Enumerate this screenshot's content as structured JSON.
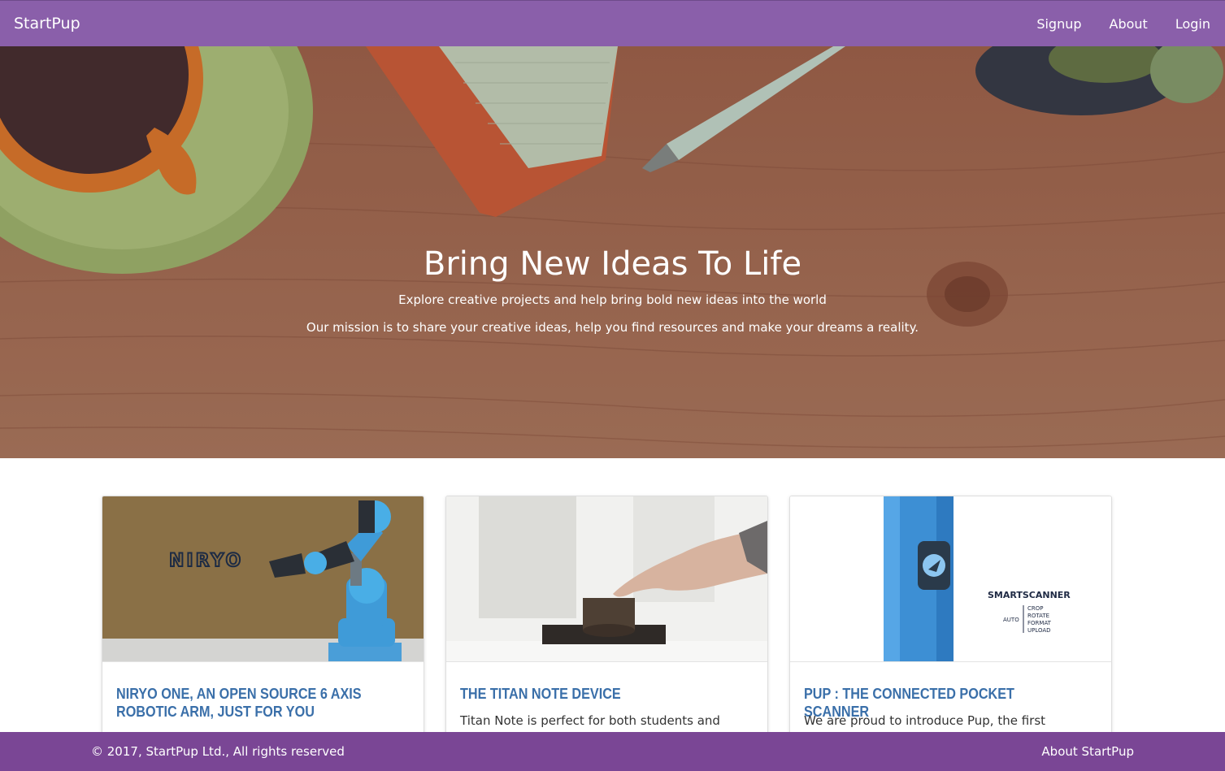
{
  "navbar": {
    "brand": "StartPup",
    "links": [
      "Signup",
      "About",
      "Login"
    ]
  },
  "hero": {
    "title": "Bring New Ideas To Life",
    "subtitle": "Explore creative projects and help bring bold new ideas into the world",
    "mission": "Our mission is to share your creative ideas, help you find resources and make your dreams a reality."
  },
  "cards": [
    {
      "title": "NIRYO ONE, AN OPEN SOURCE 6 AXIS ROBOTIC ARM, JUST FOR YOU",
      "text": "",
      "image_logo": "NIRYO"
    },
    {
      "title": "THE TITAN NOTE DEVICE",
      "text": "Titan Note is perfect for both students and"
    },
    {
      "title": "PUP : THE CONNECTED POCKET SCANNER",
      "text": "We are proud to introduce Pup, the first",
      "image_brand": "SMARTSCANNER",
      "image_auto": "AUTO",
      "image_features": [
        "CROP",
        "ROTATE",
        "FORMAT",
        "UPLOAD"
      ]
    }
  ],
  "footer": {
    "copyright": "© 2017, StartPup Ltd., All rights reserved",
    "link": "About StartPup"
  },
  "colors": {
    "navbar": "#8a5faa",
    "footer": "#7a4695",
    "card_title": "#3a6fa9",
    "hero_wood": "#a56a51"
  }
}
